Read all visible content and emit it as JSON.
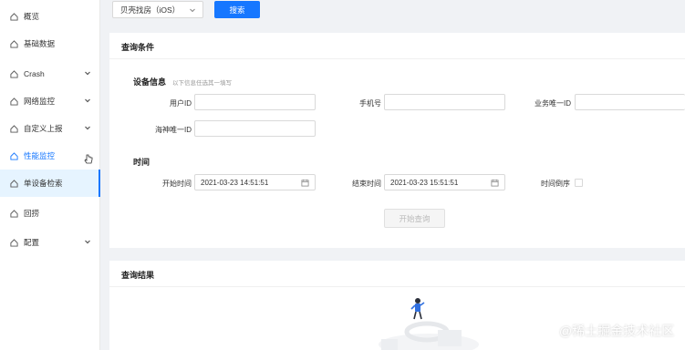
{
  "sidebar": {
    "items": [
      {
        "label": "概览",
        "icon": "home-icon"
      },
      {
        "label": "基础数据",
        "icon": "home-icon"
      },
      {
        "label": "Crash",
        "icon": "home-icon",
        "expandable": true
      },
      {
        "label": "网络监控",
        "icon": "home-icon",
        "expandable": true
      },
      {
        "label": "自定义上报",
        "icon": "home-icon",
        "expandable": true
      },
      {
        "label": "性能监控",
        "icon": "home-icon",
        "expandable": true
      },
      {
        "label": "单设备检索",
        "icon": "home-icon",
        "active": true
      },
      {
        "label": "回捞",
        "icon": "home-icon"
      },
      {
        "label": "配置",
        "icon": "home-icon",
        "expandable": true
      }
    ]
  },
  "topbar": {
    "app_select_value": "贝壳找房（iOS）",
    "search_label": "搜索"
  },
  "query": {
    "title": "查询条件",
    "device_section": {
      "title": "设备信息",
      "hint": "以下信息任选其一填写",
      "user_id_label": "用户ID",
      "phone_label": "手机号",
      "biz_id_label": "业务唯一ID",
      "haishen_id_label": "海神唯一ID"
    },
    "time_section": {
      "title": "时间",
      "start_label": "开始时间",
      "start_value": "2021-03-23 14:51:51",
      "end_label": "结束时间",
      "end_value": "2021-03-23 15:51:51",
      "reverse_label": "时间倒序"
    },
    "start_button": "开始查询"
  },
  "results": {
    "title": "查询结果"
  },
  "watermark": "@稀土掘金技术社区",
  "colors": {
    "accent": "#1677ff",
    "active_bg": "#e6f4ff"
  }
}
